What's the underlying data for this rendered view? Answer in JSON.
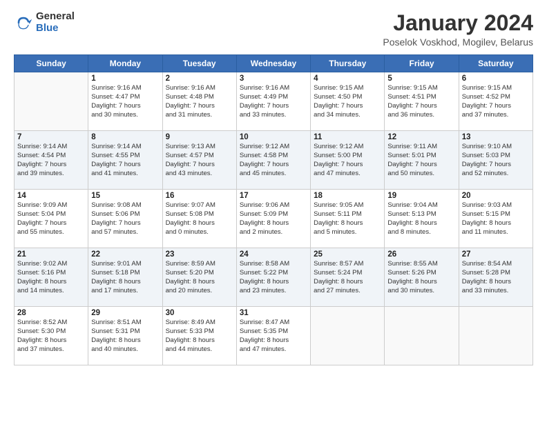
{
  "logo": {
    "general": "General",
    "blue": "Blue"
  },
  "title": "January 2024",
  "location": "Poselok Voskhod, Mogilev, Belarus",
  "days_of_week": [
    "Sunday",
    "Monday",
    "Tuesday",
    "Wednesday",
    "Thursday",
    "Friday",
    "Saturday"
  ],
  "weeks": [
    [
      {
        "num": "",
        "info": ""
      },
      {
        "num": "1",
        "info": "Sunrise: 9:16 AM\nSunset: 4:47 PM\nDaylight: 7 hours\nand 30 minutes."
      },
      {
        "num": "2",
        "info": "Sunrise: 9:16 AM\nSunset: 4:48 PM\nDaylight: 7 hours\nand 31 minutes."
      },
      {
        "num": "3",
        "info": "Sunrise: 9:16 AM\nSunset: 4:49 PM\nDaylight: 7 hours\nand 33 minutes."
      },
      {
        "num": "4",
        "info": "Sunrise: 9:15 AM\nSunset: 4:50 PM\nDaylight: 7 hours\nand 34 minutes."
      },
      {
        "num": "5",
        "info": "Sunrise: 9:15 AM\nSunset: 4:51 PM\nDaylight: 7 hours\nand 36 minutes."
      },
      {
        "num": "6",
        "info": "Sunrise: 9:15 AM\nSunset: 4:52 PM\nDaylight: 7 hours\nand 37 minutes."
      }
    ],
    [
      {
        "num": "7",
        "info": "Sunrise: 9:14 AM\nSunset: 4:54 PM\nDaylight: 7 hours\nand 39 minutes."
      },
      {
        "num": "8",
        "info": "Sunrise: 9:14 AM\nSunset: 4:55 PM\nDaylight: 7 hours\nand 41 minutes."
      },
      {
        "num": "9",
        "info": "Sunrise: 9:13 AM\nSunset: 4:57 PM\nDaylight: 7 hours\nand 43 minutes."
      },
      {
        "num": "10",
        "info": "Sunrise: 9:12 AM\nSunset: 4:58 PM\nDaylight: 7 hours\nand 45 minutes."
      },
      {
        "num": "11",
        "info": "Sunrise: 9:12 AM\nSunset: 5:00 PM\nDaylight: 7 hours\nand 47 minutes."
      },
      {
        "num": "12",
        "info": "Sunrise: 9:11 AM\nSunset: 5:01 PM\nDaylight: 7 hours\nand 50 minutes."
      },
      {
        "num": "13",
        "info": "Sunrise: 9:10 AM\nSunset: 5:03 PM\nDaylight: 7 hours\nand 52 minutes."
      }
    ],
    [
      {
        "num": "14",
        "info": "Sunrise: 9:09 AM\nSunset: 5:04 PM\nDaylight: 7 hours\nand 55 minutes."
      },
      {
        "num": "15",
        "info": "Sunrise: 9:08 AM\nSunset: 5:06 PM\nDaylight: 7 hours\nand 57 minutes."
      },
      {
        "num": "16",
        "info": "Sunrise: 9:07 AM\nSunset: 5:08 PM\nDaylight: 8 hours\nand 0 minutes."
      },
      {
        "num": "17",
        "info": "Sunrise: 9:06 AM\nSunset: 5:09 PM\nDaylight: 8 hours\nand 2 minutes."
      },
      {
        "num": "18",
        "info": "Sunrise: 9:05 AM\nSunset: 5:11 PM\nDaylight: 8 hours\nand 5 minutes."
      },
      {
        "num": "19",
        "info": "Sunrise: 9:04 AM\nSunset: 5:13 PM\nDaylight: 8 hours\nand 8 minutes."
      },
      {
        "num": "20",
        "info": "Sunrise: 9:03 AM\nSunset: 5:15 PM\nDaylight: 8 hours\nand 11 minutes."
      }
    ],
    [
      {
        "num": "21",
        "info": "Sunrise: 9:02 AM\nSunset: 5:16 PM\nDaylight: 8 hours\nand 14 minutes."
      },
      {
        "num": "22",
        "info": "Sunrise: 9:01 AM\nSunset: 5:18 PM\nDaylight: 8 hours\nand 17 minutes."
      },
      {
        "num": "23",
        "info": "Sunrise: 8:59 AM\nSunset: 5:20 PM\nDaylight: 8 hours\nand 20 minutes."
      },
      {
        "num": "24",
        "info": "Sunrise: 8:58 AM\nSunset: 5:22 PM\nDaylight: 8 hours\nand 23 minutes."
      },
      {
        "num": "25",
        "info": "Sunrise: 8:57 AM\nSunset: 5:24 PM\nDaylight: 8 hours\nand 27 minutes."
      },
      {
        "num": "26",
        "info": "Sunrise: 8:55 AM\nSunset: 5:26 PM\nDaylight: 8 hours\nand 30 minutes."
      },
      {
        "num": "27",
        "info": "Sunrise: 8:54 AM\nSunset: 5:28 PM\nDaylight: 8 hours\nand 33 minutes."
      }
    ],
    [
      {
        "num": "28",
        "info": "Sunrise: 8:52 AM\nSunset: 5:30 PM\nDaylight: 8 hours\nand 37 minutes."
      },
      {
        "num": "29",
        "info": "Sunrise: 8:51 AM\nSunset: 5:31 PM\nDaylight: 8 hours\nand 40 minutes."
      },
      {
        "num": "30",
        "info": "Sunrise: 8:49 AM\nSunset: 5:33 PM\nDaylight: 8 hours\nand 44 minutes."
      },
      {
        "num": "31",
        "info": "Sunrise: 8:47 AM\nSunset: 5:35 PM\nDaylight: 8 hours\nand 47 minutes."
      },
      {
        "num": "",
        "info": ""
      },
      {
        "num": "",
        "info": ""
      },
      {
        "num": "",
        "info": ""
      }
    ]
  ]
}
